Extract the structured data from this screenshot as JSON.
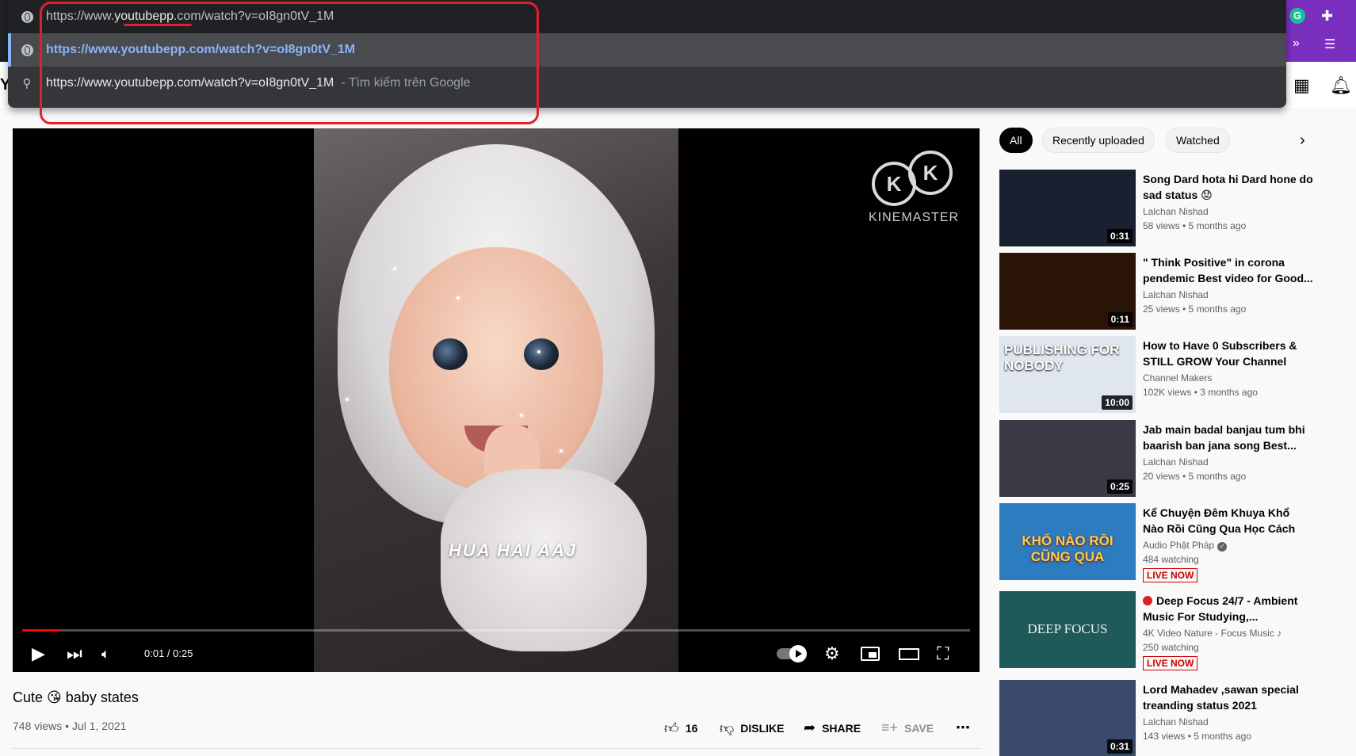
{
  "omnibox": {
    "url_prefix": "https://www.",
    "url_domain": "youtubepp",
    "url_suffix": ".com/watch?v=oI8gn0tV_1M",
    "suggestion": "https://www.youtubepp.com/watch?v=oI8gn0tV_1M",
    "search_query": "https://www.youtubepp.com/watch?v=oI8gn0tV_1M",
    "search_hint": "- Tìm kiếm trên Google"
  },
  "header": {
    "logo_fragment": "Y"
  },
  "player": {
    "caption": "HUA HAI AAJ",
    "watermark": "KINEMASTER",
    "watermark_letter": "K",
    "time": "0:01 / 0:25",
    "progress": 0.04
  },
  "video": {
    "title": "Cute 😘 baby states",
    "meta": "748 views • Jul 1, 2021",
    "likes": "16",
    "dislike": "DISLIKE",
    "share": "SHARE",
    "save": "SAVE"
  },
  "chips": [
    "All",
    "Recently uploaded",
    "Watched"
  ],
  "recommendations": [
    {
      "title": "Song Dard hota hi Dard hone do sad status 😟",
      "channel": "Lalchan Nishad",
      "stats": "58 views • 5 months ago",
      "duration": "0:31",
      "color": "#1a2030"
    },
    {
      "title": "\" Think Positive\" in corona pendemic Best video for Good...",
      "channel": "Lalchan Nishad",
      "stats": "25 views • 5 months ago",
      "duration": "0:11",
      "color": "#2a1408"
    },
    {
      "title": "How to Have 0 Subscribers & STILL GROW Your Channel",
      "channel": "Channel Makers",
      "stats": "102K views • 3 months ago",
      "duration": "10:00",
      "color": "#dfe6ee",
      "thumb_text": "PUBLISHING FOR NOBODY"
    },
    {
      "title": "Jab main badal banjau tum bhi baarish ban jana song Best...",
      "channel": "Lalchan Nishad",
      "stats": "20 views • 5 months ago",
      "duration": "0:25",
      "color": "#3a3a44"
    },
    {
      "title": "Kể Chuyện Đêm Khuya Khổ Nào Rồi Cũng Qua Học Cách Vượt...",
      "channel": "Audio Phật Pháp",
      "stats": "484 watching",
      "live": "LIVE NOW",
      "color": "#2d7cc0",
      "thumb_text": "KHỔ NÀO RỒI CŨNG QUA",
      "verified": true
    },
    {
      "title": "Deep Focus 24/7 - Ambient Music For Studying,...",
      "channel": "4K Video Nature - Focus Music",
      "stats": "250 watching",
      "live": "LIVE NOW",
      "color": "#1f5a5a",
      "thumb_text": "DEEP FOCUS",
      "live_dot": true,
      "music": true
    },
    {
      "title": "Lord Mahadev ,sawan special treanding status 2021",
      "channel": "Lalchan Nishad",
      "stats": "143 views • 5 months ago",
      "duration": "0:31",
      "color": "#3a4a6a"
    }
  ]
}
